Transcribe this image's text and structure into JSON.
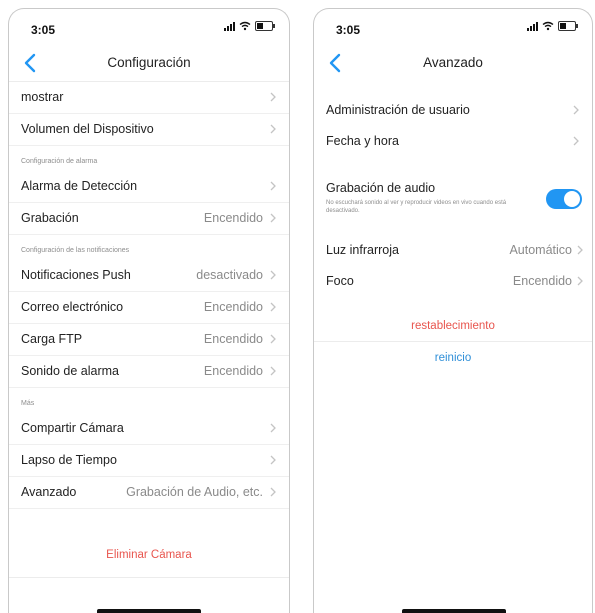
{
  "status": {
    "time": "3:05"
  },
  "left": {
    "title": "Configuración",
    "top_rows": [
      {
        "label": "mostrar",
        "value": ""
      },
      {
        "label": "Volumen del Dispositivo",
        "value": ""
      }
    ],
    "alarm_section": "Configuración de alarma",
    "alarm_rows": [
      {
        "label": "Alarma de Detección",
        "value": ""
      },
      {
        "label": "Grabación",
        "value": "Encendido"
      }
    ],
    "notif_section": "Configuración de las notificaciones",
    "notif_rows": [
      {
        "label": "Notificaciones Push",
        "value": "desactivado"
      },
      {
        "label": "Correo electrónico",
        "value": "Encendido"
      },
      {
        "label": "Carga FTP",
        "value": "Encendido"
      },
      {
        "label": "Sonido de alarma",
        "value": "Encendido"
      }
    ],
    "more_section": "Más",
    "more_rows": [
      {
        "label": "Compartir Cámara",
        "value": ""
      },
      {
        "label": "Lapso de Tiempo",
        "value": ""
      },
      {
        "label": "Avanzado",
        "value": "Grabación de Audio, etc."
      }
    ],
    "delete_label": "Eliminar Cámara"
  },
  "right": {
    "title": "Avanzado",
    "rows_top": [
      {
        "label": "Administración de usuario",
        "value": ""
      },
      {
        "label": "Fecha y hora",
        "value": ""
      }
    ],
    "audio": {
      "label": "Grabación de audio",
      "description": "No escuchará sonido al ver y reproducir videos en vivo cuando está desactivado.",
      "enabled": true
    },
    "rows_bottom": [
      {
        "label": "Luz infrarroja",
        "value": "Automático"
      },
      {
        "label": "Foco",
        "value": "Encendido"
      }
    ],
    "reset_label": "restablecimiento",
    "reboot_label": "reinicio"
  },
  "colors": {
    "accent": "#2196f3",
    "danger": "#e8554e",
    "link": "#2f8fd8",
    "secondary": "#8a8a8a"
  },
  "icons": {
    "back": "chevron-left-icon",
    "row": "chevron-right-icon"
  }
}
